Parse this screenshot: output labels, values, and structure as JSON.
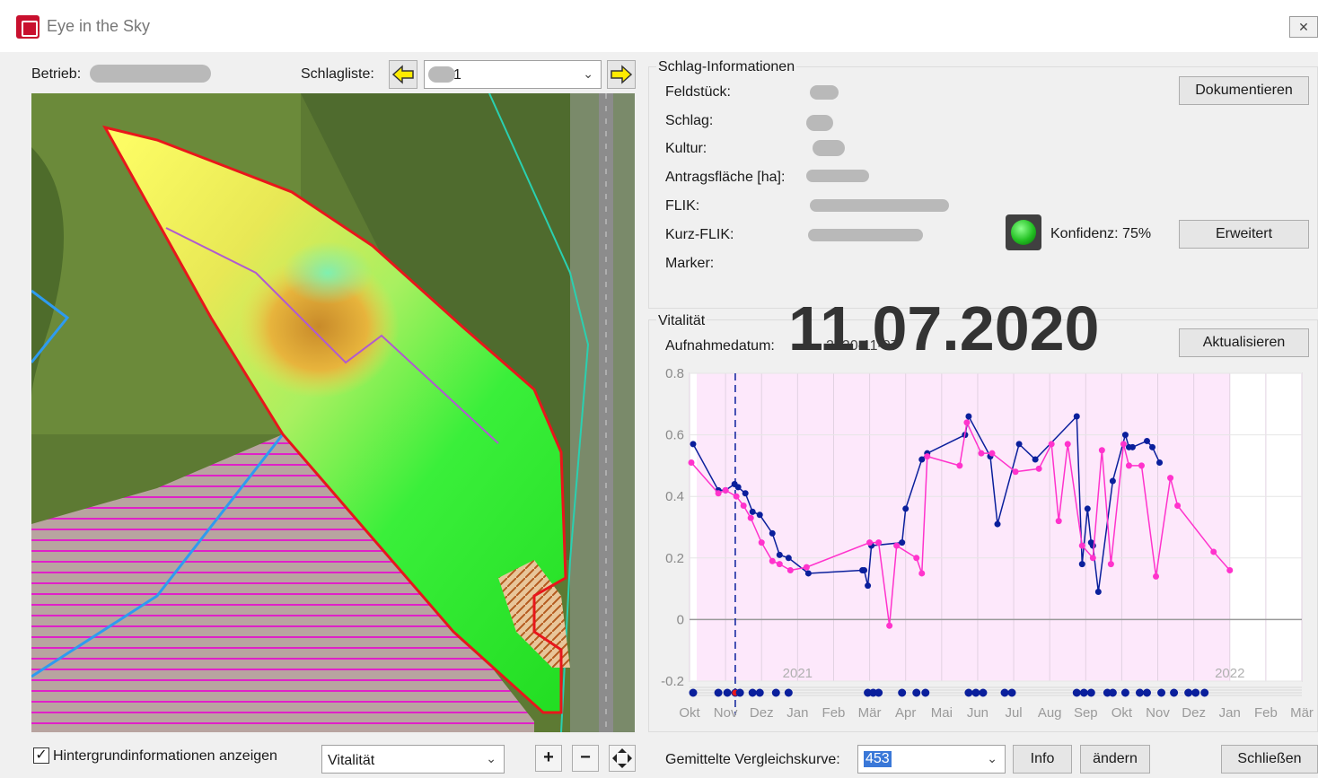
{
  "window": {
    "title": "Eye in the Sky",
    "close_glyph": "✕"
  },
  "header": {
    "betrieb_label": "Betrieb:",
    "schlagliste_label": "Schlagliste:",
    "schlag_selected": "1"
  },
  "schlag_info": {
    "group_title": "Schlag-Informationen",
    "feldstueck_label": "Feldstück:",
    "schlag_label": "Schlag:",
    "kultur_label": "Kultur:",
    "antragsflaeche_label": "Antragsfläche [ha]:",
    "flik_label": "FLIK:",
    "kurz_flik_label": "Kurz-FLIK:",
    "marker_label": "Marker:",
    "konfidenz_text": "Konfidenz: 75%",
    "dokumentieren_label": "Dokumentieren",
    "erweitert_label": "Erweitert"
  },
  "vitalitaet": {
    "group_title": "Vitalität",
    "aufnahmedatum_label": "Aufnahmedatum:",
    "aufnahmedatum_value": "2020-11-07",
    "aktualisieren_label": "Aktualisieren",
    "big_date": "11.07.2020"
  },
  "bottom": {
    "hintergrund_label": "Hintergrundinformationen anzeigen",
    "hintergrund_checked": true,
    "layer_selected": "Vitalität",
    "vergleich_label": "Gemittelte Vergleichskurve:",
    "vergleich_value": "453",
    "info_label": "Info",
    "aendern_label": "ändern",
    "schliessen_label": "Schließen"
  },
  "colors": {
    "accent_yellow": "#ffeb00",
    "status_green": "#22c022",
    "series_blue": "#0a1f9c",
    "series_magenta": "#ff33cc",
    "field_outline": "#e8161b"
  },
  "chart_data": {
    "type": "line",
    "ylim": [
      -0.2,
      0.8
    ],
    "y_ticks": [
      -0.2,
      0,
      0.2,
      0.4,
      0.6,
      0.8
    ],
    "y_tick_labels": [
      "-0.2",
      "0",
      "0.2",
      "0.4",
      "0.6",
      "0.8"
    ],
    "x_range_months": [
      0,
      17
    ],
    "month_labels": [
      "Okt",
      "Nov",
      "Dez",
      "Jan",
      "Feb",
      "Mär",
      "Apr",
      "Mai",
      "Jun",
      "Jul",
      "Aug",
      "Sep",
      "Okt",
      "Nov",
      "Dez",
      "Jan",
      "Feb",
      "Mär"
    ],
    "year_labels": [
      {
        "label": "2021",
        "x": 3.0
      },
      {
        "label": "2022",
        "x": 15.0
      }
    ],
    "shaded_range": [
      0.2,
      15.0
    ],
    "selected_date_x": 1.27,
    "series": [
      {
        "x": [
          0.1,
          0.8,
          1.0,
          1.25,
          1.35,
          1.55,
          1.75,
          1.95,
          2.3,
          2.5,
          2.75,
          3.3,
          4.8,
          4.85,
          4.95,
          5.05,
          5.9,
          6.0,
          6.45,
          6.6,
          7.65,
          7.75,
          8.35,
          8.55,
          9.15,
          9.6,
          10.75,
          10.9,
          11.05,
          11.15,
          11.2,
          11.35,
          11.75,
          12.1,
          12.2,
          12.3,
          12.7,
          12.85,
          13.05
        ],
        "y": [
          0.57,
          0.42,
          0.42,
          0.44,
          0.43,
          0.41,
          0.35,
          0.34,
          0.28,
          0.21,
          0.2,
          0.15,
          0.16,
          0.16,
          0.11,
          0.24,
          0.25,
          0.36,
          0.52,
          0.54,
          0.6,
          0.66,
          0.53,
          0.31,
          0.57,
          0.52,
          0.66,
          0.18,
          0.36,
          0.25,
          0.24,
          0.09,
          0.45,
          0.6,
          0.56,
          0.56,
          0.58,
          0.56,
          0.51
        ]
      },
      {
        "x": [
          0.05,
          0.8,
          1.0,
          1.3,
          1.5,
          1.7,
          2.0,
          2.3,
          2.5,
          2.8,
          3.25,
          5.0,
          5.25,
          5.55,
          5.75,
          6.3,
          6.45,
          6.6,
          7.5,
          7.7,
          8.1,
          8.4,
          9.05,
          9.7,
          10.05,
          10.25,
          10.5,
          10.9,
          11.2,
          11.45,
          11.7,
          12.05,
          12.2,
          12.55,
          12.95,
          13.35,
          13.55,
          14.55,
          15.0
        ],
        "y": [
          0.51,
          0.41,
          0.42,
          0.4,
          0.37,
          0.33,
          0.25,
          0.19,
          0.18,
          0.16,
          0.17,
          0.25,
          0.25,
          -0.02,
          0.24,
          0.2,
          0.15,
          0.53,
          0.5,
          0.64,
          0.54,
          0.54,
          0.48,
          0.49,
          0.57,
          0.32,
          0.57,
          0.24,
          0.2,
          0.55,
          0.18,
          0.57,
          0.5,
          0.5,
          0.14,
          0.46,
          0.37,
          0.22,
          0.16
        ]
      }
    ],
    "acquisition_markers": {
      "x": [
        0.1,
        0.8,
        1.05,
        1.27,
        1.4,
        1.75,
        1.95,
        2.4,
        2.75,
        4.95,
        5.1,
        5.25,
        5.9,
        6.3,
        6.55,
        7.75,
        7.95,
        8.15,
        8.75,
        8.95,
        10.75,
        10.95,
        11.15,
        11.6,
        11.75,
        12.1,
        12.5,
        12.7,
        13.1,
        13.45,
        13.85,
        14.05,
        14.3
      ],
      "highlighted_x": 1.27
    }
  }
}
